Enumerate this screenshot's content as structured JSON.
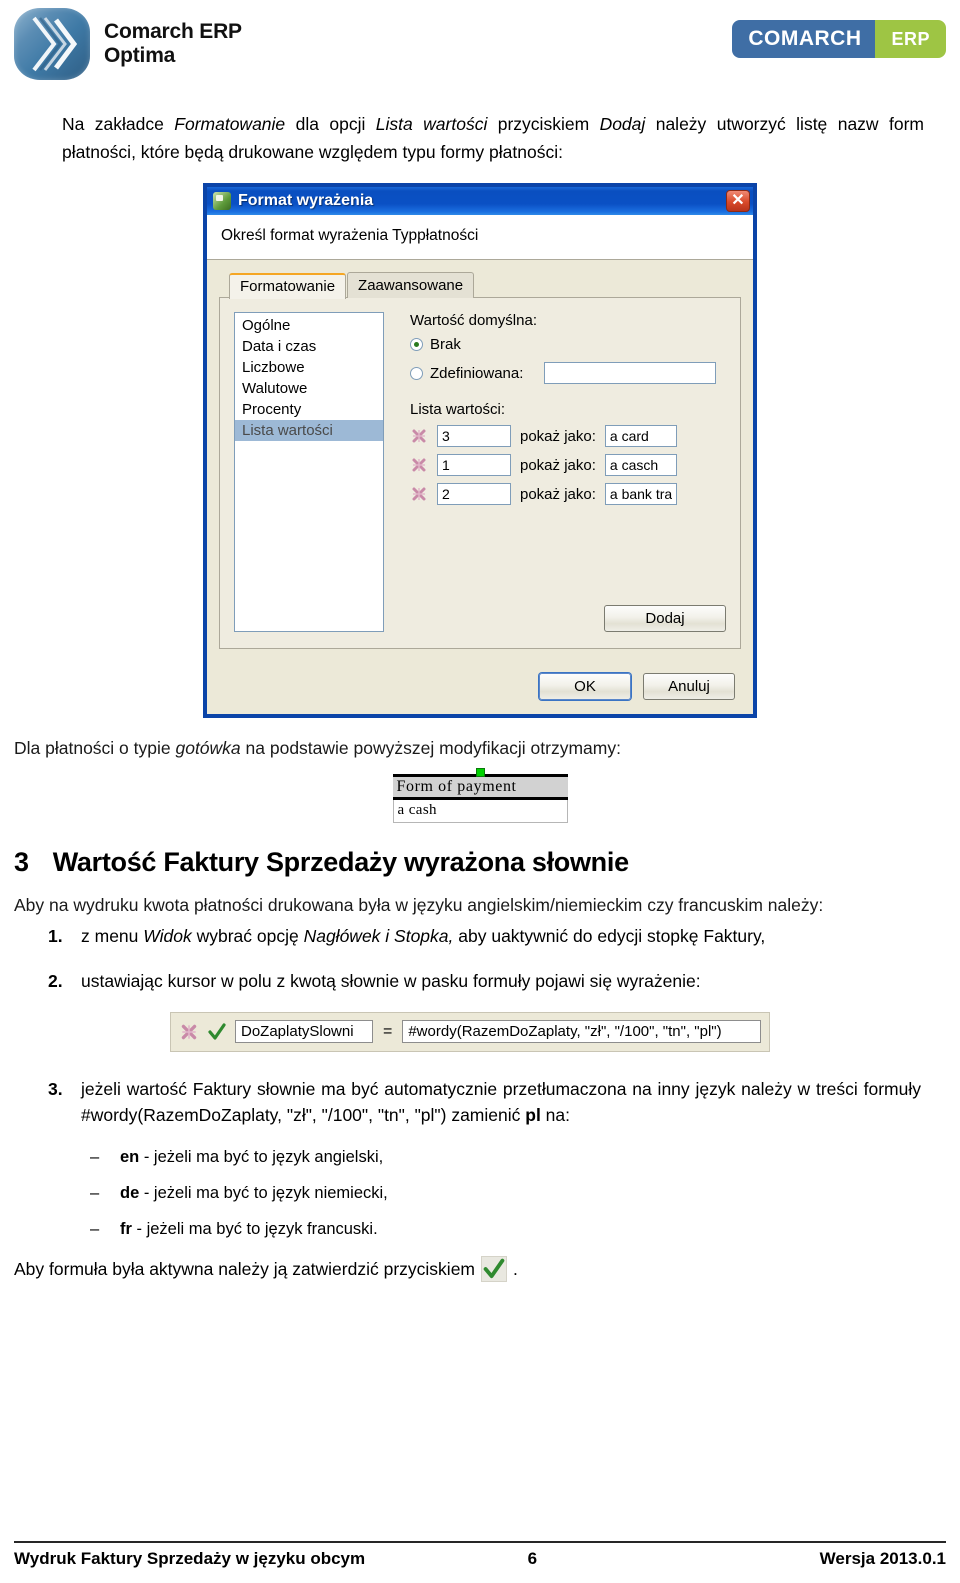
{
  "header": {
    "brand_line1": "Comarch ERP",
    "brand_line2": "Optima",
    "badge_left": "COMARCH",
    "badge_right": "ERP",
    "logo_icon": "comarch-chevron-logo"
  },
  "intro": {
    "text_part1": "Na zakładce ",
    "em1": "Formatowanie",
    "text_part2": " dla opcji ",
    "em2": "Lista wartości",
    "text_part3": " przyciskiem ",
    "em3": "Dodaj",
    "text_part4": " należy utworzyć listę nazw form płatności, które będą drukowane względem typu formy płatności:"
  },
  "dialog": {
    "title": "Format wyrażenia",
    "title_icon": "application-icon",
    "close_label": "✕",
    "banner": "Określ format wyrażenia Typpłatności",
    "tabs": [
      {
        "label": "Formatowanie",
        "active": true
      },
      {
        "label": "Zaawansowane",
        "active": false
      }
    ],
    "categories": [
      {
        "label": "Ogólne",
        "selected": false
      },
      {
        "label": "Data i czas",
        "selected": false
      },
      {
        "label": "Liczbowe",
        "selected": false
      },
      {
        "label": "Walutowe",
        "selected": false
      },
      {
        "label": "Procenty",
        "selected": false
      },
      {
        "label": "Lista wartości",
        "selected": true
      }
    ],
    "default_value_label": "Wartość domyślna:",
    "radio_none": "Brak",
    "radio_defined": "Zdefiniowana:",
    "defined_value": "",
    "value_list_label": "Lista wartości:",
    "show_as_label": "pokaż jako:",
    "value_rows": [
      {
        "key": "3",
        "shown_as": "a card"
      },
      {
        "key": "1",
        "shown_as": "a casch"
      },
      {
        "key": "2",
        "shown_as": "a bank tra"
      }
    ],
    "add_button": "Dodaj",
    "ok_button": "OK",
    "cancel_button": "Anuluj",
    "delete_icon": "delete-row-icon"
  },
  "after_dialog": {
    "text_part1": "Dla płatności o typie ",
    "em1": "gotówka",
    "text_part2": " na podstawie powyższej modyfikacji otrzymamy:"
  },
  "fop_shot": {
    "header": "Form of payment",
    "value": "a cash",
    "handle_icon": "resize-handle"
  },
  "section3": {
    "number": "3",
    "title": "Wartość Faktury Sprzedaży wyrażona słownie",
    "lead": "Aby na wydruku kwota płatności drukowana była w języku angielskim/niemieckim czy francuskim należy:",
    "items": [
      {
        "num": "1.",
        "t1": "z menu ",
        "em1": "Widok",
        "t2": " wybrać opcję ",
        "em2": "Nagłówek i Stopka,",
        "t3": " aby uaktywnić do edycji stopkę Faktury,"
      },
      {
        "num": "2.",
        "t1": "ustawiając kursor w polu z kwotą słownie w pasku formuły pojawi się wyrażenie:"
      },
      {
        "num": "3.",
        "t1": "jeżeli wartość Faktury słownie ma być automatycznie przetłumaczona na inny język należy w treści formuły #wordy(RazemDoZaplaty, \"zł\", \"/100\", \"tn\", \"pl\") zamienić ",
        "b1": "pl",
        "t2": " na:"
      }
    ]
  },
  "formula_bar": {
    "delete_icon": "delete-formula-icon",
    "accept_icon": "accept-check-icon",
    "name": "DoZaplatySlowni",
    "equals": "=",
    "value": "#wordy(RazemDoZaplaty, \"zł\", \"/100\", \"tn\", \"pl\")"
  },
  "lang_list": [
    {
      "mark": "–",
      "code": "en",
      "text": " - jeżeli ma być to język angielski,"
    },
    {
      "mark": "–",
      "code": "de",
      "text": " - jeżeli ma być to język niemiecki,"
    },
    {
      "mark": "–",
      "code": "fr",
      "text": " - jeżeli ma być to język francuski."
    }
  ],
  "closing": {
    "text_before": "Aby formuła była aktywna należy ją zatwierdzić przyciskiem",
    "icon": "green-check-icon",
    "text_after": "."
  },
  "footer": {
    "left": "Wydruk Faktury Sprzedaży w języku obcym",
    "page": "6",
    "right": "Wersja 2013.0.1"
  },
  "colors": {
    "brand_blue": "#3f6ea5",
    "brand_green": "#9ec544",
    "xp_title_blue": "#0a4fc0",
    "selection_blue": "#9db9d6",
    "accent_orange": "#f5a623"
  }
}
